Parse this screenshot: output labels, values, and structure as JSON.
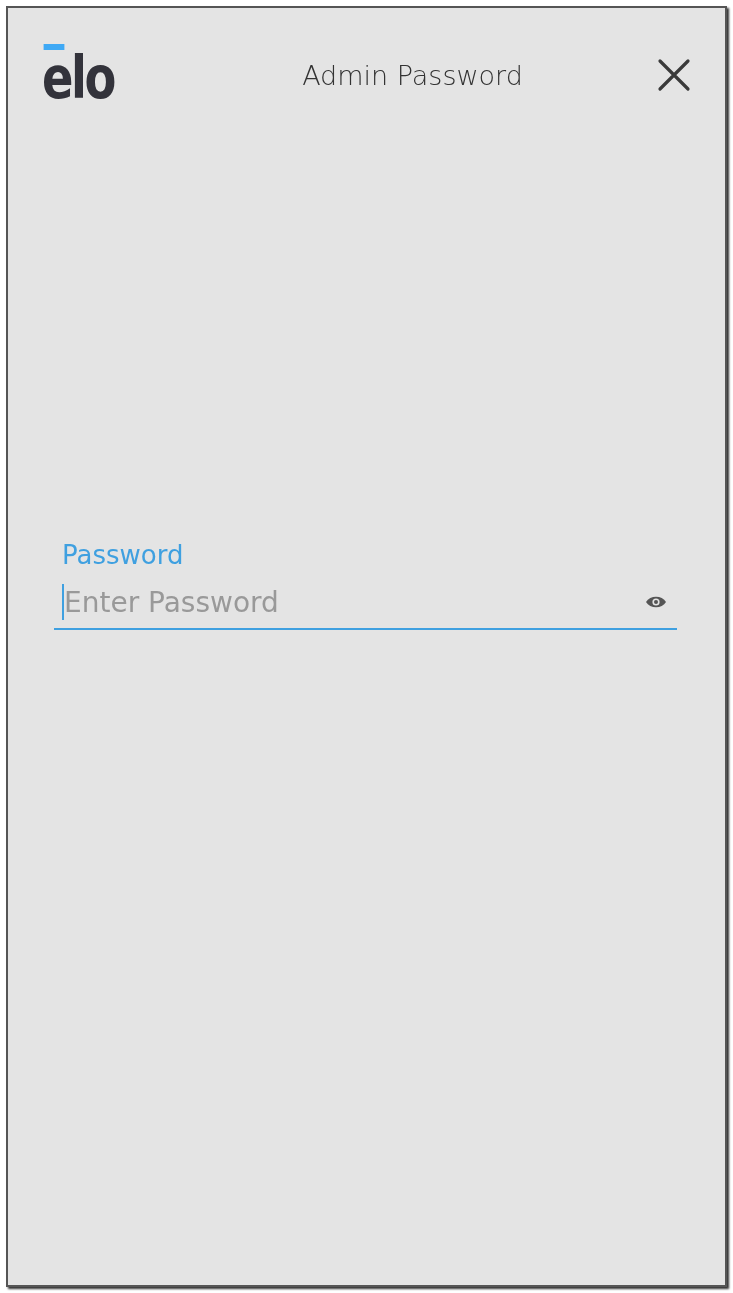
{
  "header": {
    "logo": "elo",
    "title": "Admin Password"
  },
  "password_field": {
    "label": "Password",
    "placeholder": "Enter Password",
    "focused": true
  }
}
